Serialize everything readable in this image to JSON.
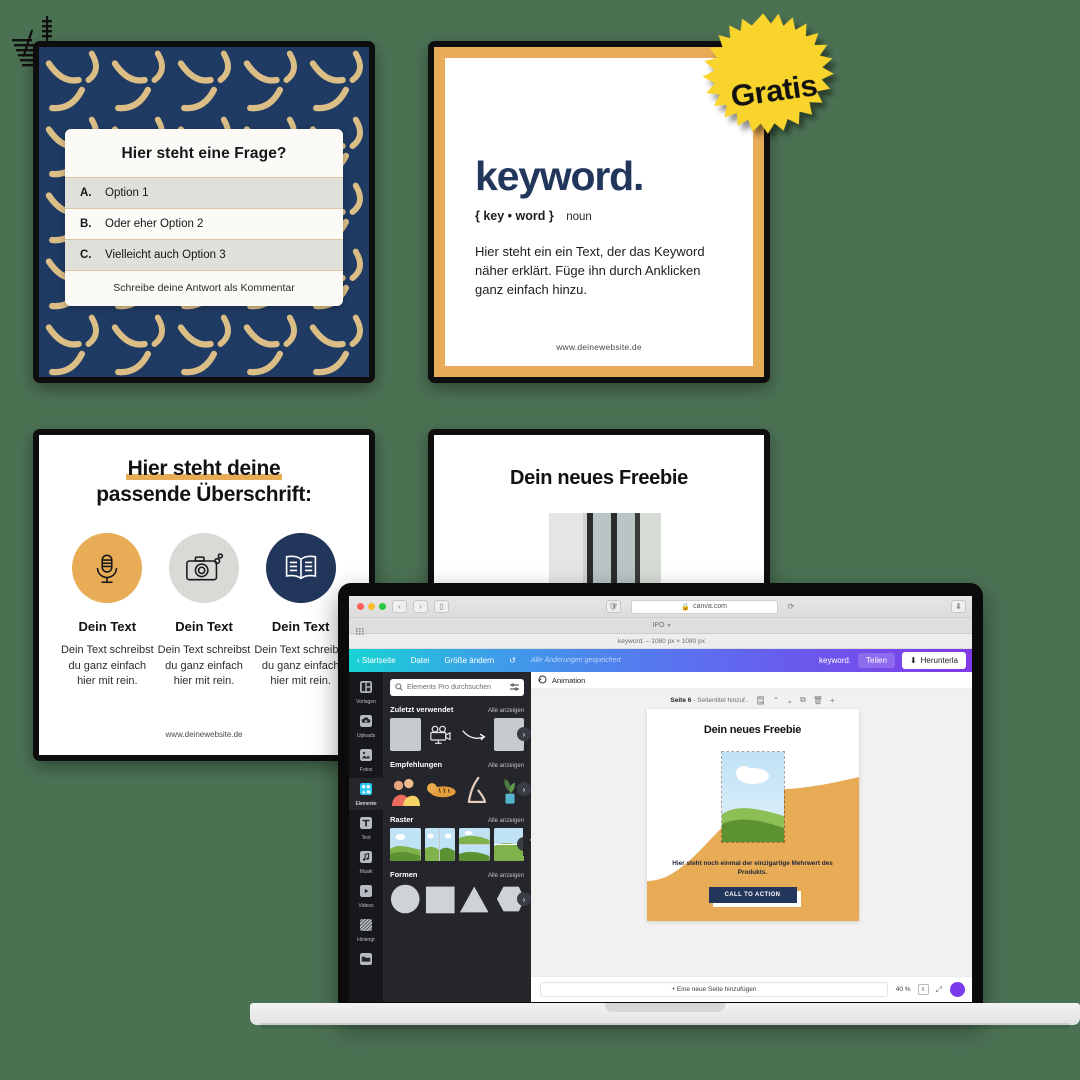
{
  "background_color": "#4b7153",
  "palette": {
    "navy": "#1f3a63",
    "gold": "#e8ac56",
    "yellow": "#f8d42c",
    "dark": "#0e0e0e",
    "panel_dark": "#25262b"
  },
  "card_quiz": {
    "name": "Quiz-Vorlage",
    "question": "Hier steht eine Frage?",
    "options": [
      {
        "letter": "A.",
        "text": "Option 1"
      },
      {
        "letter": "B.",
        "text": "Oder eher Option 2"
      },
      {
        "letter": "C.",
        "text": "Vielleicht auch Option 3"
      }
    ],
    "footer": "Schreibe deine Antwort als Kommentar"
  },
  "card_keyword": {
    "title": "keyword.",
    "phonetic": "{ key • word }",
    "part_of_speech": "noun",
    "body": "Hier steht ein ein Text, der das Keyword näher erklärt. Füge ihn durch Anklicken ganz einfach hinzu.",
    "url": "www.deinewebsite.de"
  },
  "gratis_badge": {
    "label": "Gratis",
    "color": "#f8d42c"
  },
  "card_heading": {
    "title_line1": "Hier steht deine",
    "title_line2": "passende Überschrift:",
    "columns": [
      {
        "icon": "microphone-icon",
        "circle_color": "#e8ac56",
        "name": "Dein Text",
        "desc": "Dein Text schreibst du ganz einfach hier mit rein."
      },
      {
        "icon": "camera-icon",
        "circle_color": "#d9dad6",
        "name": "Dein Text",
        "desc": "Dein Text schreibst du ganz einfach hier mit rein."
      },
      {
        "icon": "book-icon",
        "circle_color": "#22365c",
        "name": "Dein Text",
        "desc": "Dein Text schreibst du ganz einfach hier mit rein."
      }
    ],
    "url": "www.deinewebsite.de"
  },
  "card_freebie": {
    "title": "Dein neues Freebie"
  },
  "laptop": {
    "browser": {
      "url": "canva.com",
      "tab_label": "IPO",
      "document_title": "keyword. – 1080 px × 1080 px"
    },
    "canva_toolbar": {
      "home": "Startseite",
      "file": "Datei",
      "resize": "Größe ändern",
      "undo_icon": "undo-icon",
      "save_status": "Alle Änderungen gespeichert",
      "design_name": "keyword.",
      "share": "Teilen",
      "download": "Herunterla",
      "download_icon": "download-icon"
    },
    "rail": [
      {
        "label": "Vorlagen",
        "icon": "templates-icon",
        "active": false
      },
      {
        "label": "Uploads",
        "icon": "upload-icon",
        "active": false
      },
      {
        "label": "Fotos",
        "icon": "photo-icon",
        "active": false
      },
      {
        "label": "Elemente",
        "icon": "elements-icon",
        "active": true
      },
      {
        "label": "Text",
        "icon": "text-icon",
        "active": false
      },
      {
        "label": "Musik",
        "icon": "music-icon",
        "active": false
      },
      {
        "label": "Videos",
        "icon": "video-icon",
        "active": false
      },
      {
        "label": "Hintergr",
        "icon": "background-icon",
        "active": false
      },
      {
        "label": "",
        "icon": "folder-icon",
        "active": false
      }
    ],
    "panel": {
      "search_placeholder": "Elements Pro durchsuchen",
      "filter_icon": "filter-icon",
      "search_icon": "search-icon",
      "sections": [
        {
          "title": "Zuletzt verwendet",
          "all": "Alle anzeigen"
        },
        {
          "title": "Empfehlungen",
          "all": "Alle anzeigen"
        },
        {
          "title": "Raster",
          "all": "Alle anzeigen"
        },
        {
          "title": "Formen",
          "all": "Alle anzeigen"
        }
      ]
    },
    "canvas": {
      "animation_label": "Animation",
      "animation_icon": "animation-icon",
      "page_label_bold": "Seite 6",
      "page_label_rest": "- Seitentitel hinzuf..",
      "page_icons": [
        "note-icon",
        "chevron-up-icon",
        "chevron-down-icon",
        "duplicate-icon",
        "trash-icon",
        "plus-icon"
      ],
      "design": {
        "title": "Dein neues Freebie",
        "text": "Hier steht noch einmal der einzigartige Mehrwert des Produkts.",
        "cta": "CALL TO ACTION"
      }
    },
    "bottom": {
      "add_page": "+ Eine neue Seite hinzufügen",
      "zoom": "40 %",
      "page_icon": "pages-icon",
      "fullscreen_icon": "fullscreen-icon"
    }
  }
}
